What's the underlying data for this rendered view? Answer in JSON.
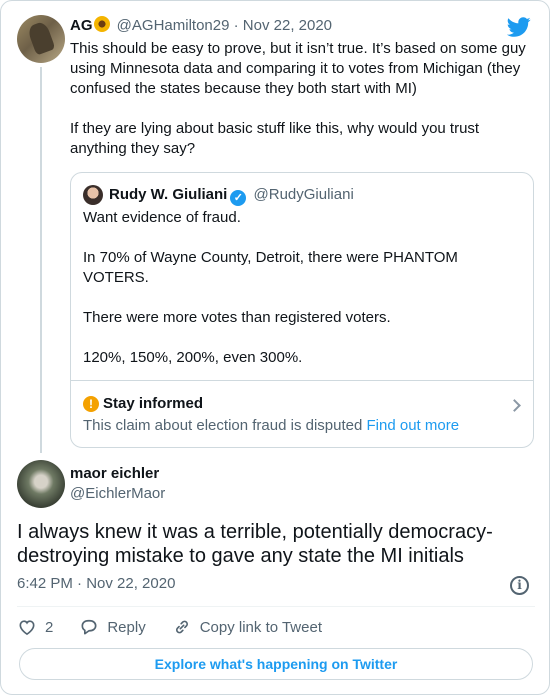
{
  "parent": {
    "name": "AG",
    "emoji_icon": "sunflower-icon",
    "handle": "@AGHamilton29",
    "separator": "·",
    "date": "Nov 22, 2020",
    "text_p1": "This should be easy to prove, but it isn’t true. It’s based on some guy using Minnesota data and comparing it to votes from Michigan (they confused the states because they both start with MI)",
    "text_p2": "If they are lying about basic stuff like this, why would you trust anything they say?"
  },
  "quote": {
    "name": "Rudy W. Giuliani",
    "verified_glyph": "✓",
    "handle": "@RudyGiuliani",
    "lines": [
      "Want evidence of fraud.",
      "In 70% of Wayne County, Detroit, there were PHANTOM VOTERS.",
      "There were more votes than registered voters.",
      "120%, 150%, 200%, even 300%."
    ],
    "notice": {
      "icon_glyph": "!",
      "title": "Stay informed",
      "description": "This claim about election fraud is disputed",
      "link": "Find out more"
    }
  },
  "reply": {
    "name": "maor eichler",
    "handle": "@EichlerMaor",
    "text": "I always knew it was a terrible, potentially democracy-destroying mistake to gave any state the MI initials",
    "timestamp": "6:42 PM · Nov 22, 2020",
    "info_glyph": "i"
  },
  "actions": {
    "like_count": "2",
    "reply_label": "Reply",
    "copy_label": "Copy link to Tweet"
  },
  "explore_label": "Explore what's happening on Twitter",
  "colors": {
    "accent": "#1d9bf0",
    "muted": "#536471",
    "border": "#cfd9de",
    "warning": "#f4a100"
  }
}
